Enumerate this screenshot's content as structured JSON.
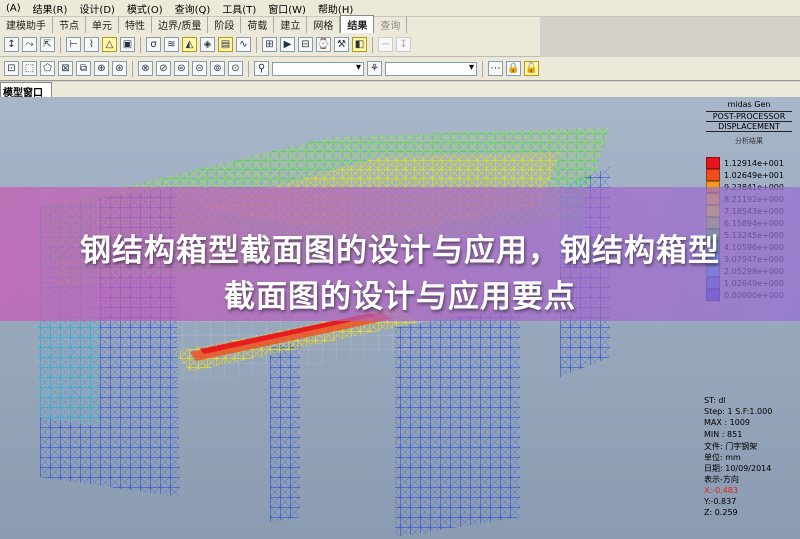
{
  "menu": [
    "(A)",
    "结果(R)",
    "设计(D)",
    "模式(O)",
    "查询(Q)",
    "工具(T)",
    "窗口(W)",
    "帮助(H)"
  ],
  "tabs": [
    {
      "label": "建模助手",
      "state": "normal"
    },
    {
      "label": "节点",
      "state": "normal"
    },
    {
      "label": "单元",
      "state": "normal"
    },
    {
      "label": "特性",
      "state": "normal"
    },
    {
      "label": "边界/质量",
      "state": "normal"
    },
    {
      "label": "阶段",
      "state": "normal"
    },
    {
      "label": "荷载",
      "state": "normal"
    },
    {
      "label": "建立",
      "state": "normal"
    },
    {
      "label": "网格",
      "state": "normal"
    },
    {
      "label": "结果",
      "state": "active"
    },
    {
      "label": "查询",
      "state": "dim"
    }
  ],
  "window": {
    "title": "模型窗口"
  },
  "legend": {
    "header1": "midas Gen",
    "header2": "POST-PROCESSOR",
    "header3": "DISPLACEMENT",
    "header4": "分析结果",
    "scale": [
      {
        "value": "1.12914e+001",
        "color": "#e8141c"
      },
      {
        "value": "1.02649e+001",
        "color": "#f04d1c"
      },
      {
        "value": "9.23841e+000",
        "color": "#f39a1a"
      },
      {
        "value": "8.21192e+000",
        "color": "#f6d21a"
      },
      {
        "value": "7.18543e+000",
        "color": "#e8ee16"
      },
      {
        "value": "6.15894e+000",
        "color": "#9ee83a"
      },
      {
        "value": "5.13245e+000",
        "color": "#3edc4a"
      },
      {
        "value": "4.10596e+000",
        "color": "#28d8a6"
      },
      {
        "value": "3.07947e+000",
        "color": "#20d0dc"
      },
      {
        "value": "2.05298e+000",
        "color": "#3aa6ec"
      },
      {
        "value": "1.02649e+000",
        "color": "#3a78e6"
      },
      {
        "value": "0.00000e+000",
        "color": "#2c4fd8"
      }
    ],
    "info": [
      {
        "text": "ST: dl",
        "color": "normal"
      },
      {
        "text": "Step: 1 S.F:1.000",
        "color": "normal"
      },
      {
        "text": "MAX : 1009",
        "color": "normal"
      },
      {
        "text": "MIN : 851",
        "color": "normal"
      },
      {
        "text": "文件: 门字钢架",
        "color": "normal"
      },
      {
        "text": "单位: mm",
        "color": "normal"
      },
      {
        "text": "日期: 10/09/2014",
        "color": "normal"
      },
      {
        "text": "表示-方向",
        "color": "normal"
      },
      {
        "text": "X:-0.483",
        "color": "red"
      },
      {
        "text": "Y:-0.837",
        "color": "normal"
      },
      {
        "text": "Z: 0.259",
        "color": "normal"
      }
    ]
  },
  "banner": {
    "line1": "钢结构箱型截面图的设计与应用，钢结构箱型",
    "line2": "截面图的设计与应用要点"
  },
  "colors": {
    "banner_start": "#c85ab4",
    "banner_end": "#966ed2",
    "viewport_top": "#a7b6c9"
  }
}
